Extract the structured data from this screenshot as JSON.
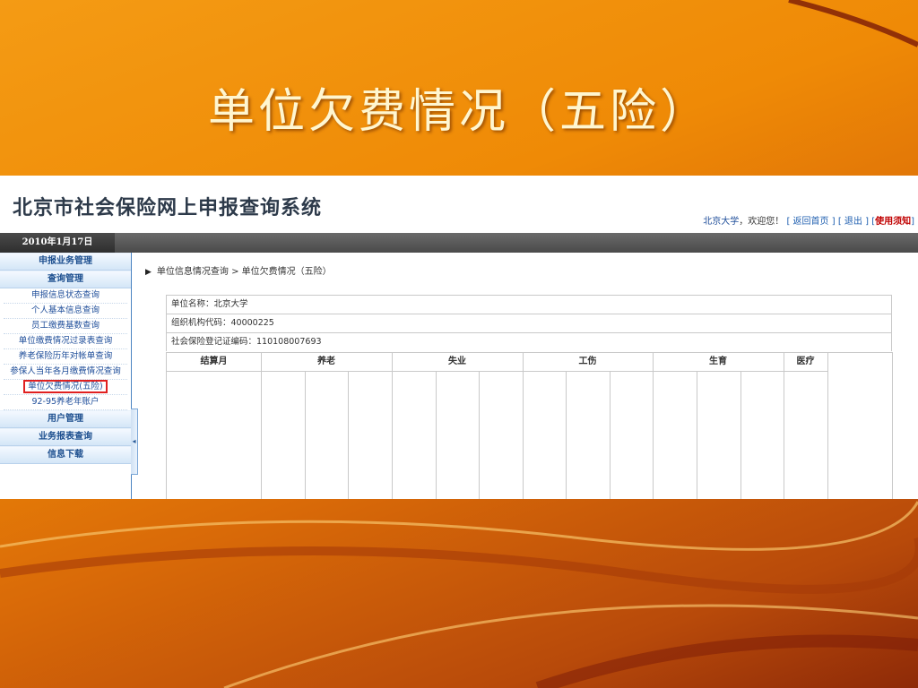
{
  "slide": {
    "title": "单位欠费情况（五险）"
  },
  "app": {
    "system_title": "北京市社会保险网上申报查询系统",
    "user_name": "北京大学",
    "welcome": "，欢迎您！",
    "links": {
      "home": "[ 返回首页 ]",
      "logout": "[ 退出 ]",
      "notice_open": "[",
      "notice": "使用须知",
      "notice_close": "]"
    },
    "date": "2010年1月17日"
  },
  "sidebar": {
    "sections": [
      {
        "label": "申报业务管理"
      },
      {
        "label": "查询管理"
      }
    ],
    "query_items": [
      {
        "label": "申报信息状态查询"
      },
      {
        "label": "个人基本信息查询"
      },
      {
        "label": "员工缴费基数查询"
      },
      {
        "label": "单位缴费情况过录表查询"
      },
      {
        "label": "养老保险历年对帐单查询"
      },
      {
        "label": "参保人当年各月缴费情况查询"
      },
      {
        "label": "单位欠费情况(五险)"
      },
      {
        "label": "92-95养老年账户"
      }
    ],
    "bottom_sections": [
      {
        "label": "用户管理"
      },
      {
        "label": "业务报表查询"
      },
      {
        "label": "信息下载"
      }
    ]
  },
  "main": {
    "breadcrumb": "单位信息情况查询 > 单位欠费情况（五险）",
    "info": {
      "unit_name": "单位名称：北京大学",
      "org_code": "组织机构代码：40000225",
      "ss_code": "社会保险登记证编码：110108007693"
    },
    "columns": [
      "结算月",
      "养老",
      "失业",
      "工伤",
      "生育",
      "医疗"
    ]
  }
}
